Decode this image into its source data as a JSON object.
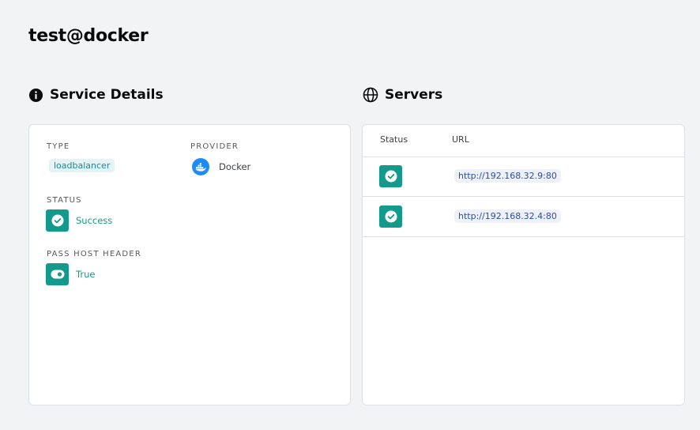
{
  "page": {
    "title": "test@docker"
  },
  "details": {
    "header": "Service Details",
    "type_label": "TYPE",
    "type_value": "loadbalancer",
    "provider_label": "PROVIDER",
    "provider_value": "Docker",
    "status_label": "STATUS",
    "status_value": "Success",
    "pass_host_header_label": "PASS HOST HEADER",
    "pass_host_header_value": "True"
  },
  "servers": {
    "header": "Servers",
    "columns": {
      "status": "Status",
      "url": "URL"
    },
    "rows": [
      {
        "status": "success",
        "url": "http://192.168.32.9:80"
      },
      {
        "status": "success",
        "url": "http://192.168.32.4:80"
      }
    ]
  },
  "icons": {
    "details_header": "info-icon",
    "servers_header": "globe-icon",
    "provider": "docker-icon",
    "status": "check-circle-icon",
    "pass_host_header": "toggle-icon"
  },
  "colors": {
    "accent_teal": "#139a8c",
    "type_chip_bg": "#e4f3f5",
    "url_chip_bg": "#eef1f7",
    "url_text": "#2c4fa3",
    "docker_blue": "#1d8cf8"
  }
}
